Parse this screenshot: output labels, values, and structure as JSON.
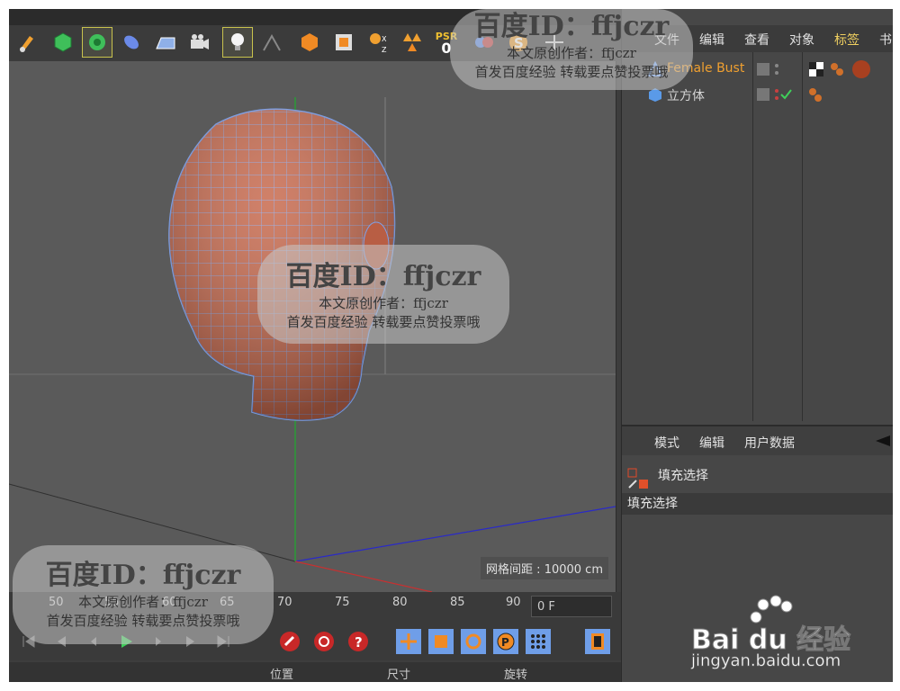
{
  "toolbar": {
    "psr_label": "PSR",
    "psr_value": "0",
    "xyz_label": "X Y Z"
  },
  "viewport": {
    "grid_spacing": "网格间距 : 10000 cm"
  },
  "timeline": {
    "ticks": [
      "50",
      "55",
      "60",
      "65",
      "70",
      "75",
      "80",
      "85",
      "90"
    ],
    "current_frame": "0 F"
  },
  "bottom_bar": {
    "labels": [
      "位置",
      "尺寸",
      "旋转"
    ]
  },
  "object_manager": {
    "menu": [
      "文件",
      "编辑",
      "查看",
      "对象",
      "标签",
      "书"
    ],
    "objects": [
      {
        "name": "Female Bust",
        "selected": true
      },
      {
        "name": "立方体",
        "selected": false
      }
    ]
  },
  "attribute_manager": {
    "menu": [
      "模式",
      "编辑",
      "用户数据"
    ],
    "title": "填充选择",
    "section": "填充选择"
  },
  "watermark": {
    "title": "百度ID：ffjczr",
    "line1": "本文原创作者：ffjczr",
    "line2": "首发百度经验  转载要点赞投票哦"
  },
  "baidu_logo": {
    "brand": "Bai du 经验",
    "url": "jingyan.baidu.com"
  },
  "colors": {
    "accent_orange": "#f0a030",
    "viewport_bg": "#5a5a5a",
    "panel_bg": "#474747",
    "mesh_fill": "#c86a4e",
    "mesh_wire": "#7fa0e8"
  }
}
